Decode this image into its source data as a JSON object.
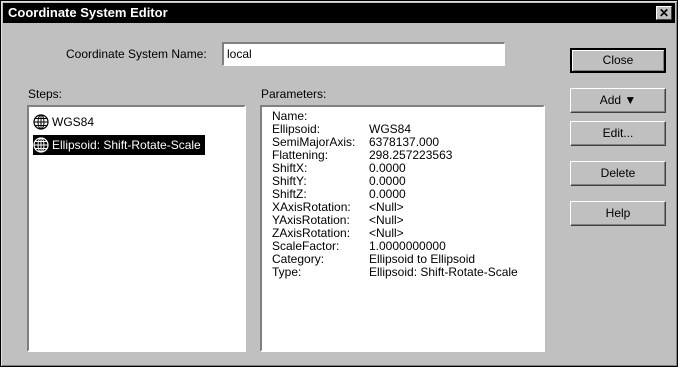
{
  "window": {
    "title": "Coordinate System Editor",
    "close_glyph": "✕"
  },
  "name_field": {
    "label": "Coordinate System Name:",
    "value": "local"
  },
  "steps": {
    "label": "Steps:",
    "items": [
      {
        "label": "WGS84",
        "icon": "globe-icon",
        "selected": false
      },
      {
        "label": "Ellipsoid: Shift-Rotate-Scale",
        "icon": "globe-icon",
        "selected": true
      }
    ]
  },
  "parameters": {
    "label": "Parameters:",
    "rows": [
      {
        "key": "Name:",
        "value": ""
      },
      {
        "key": "Ellipsoid:",
        "value": "WGS84"
      },
      {
        "key": "SemiMajorAxis:",
        "value": "6378137.000"
      },
      {
        "key": "Flattening:",
        "value": "298.257223563"
      },
      {
        "key": "ShiftX:",
        "value": "0.0000"
      },
      {
        "key": "ShiftY:",
        "value": "0.0000"
      },
      {
        "key": "ShiftZ:",
        "value": "0.0000"
      },
      {
        "key": "XAxisRotation:",
        "value": "<Null>"
      },
      {
        "key": "YAxisRotation:",
        "value": "<Null>"
      },
      {
        "key": "ZAxisRotation:",
        "value": "<Null>"
      },
      {
        "key": "ScaleFactor:",
        "value": "1.0000000000"
      },
      {
        "key": "Category:",
        "value": "Ellipsoid to Ellipsoid"
      },
      {
        "key": "Type:",
        "value": "Ellipsoid: Shift-Rotate-Scale"
      }
    ]
  },
  "buttons": {
    "close": "Close",
    "add": "Add ▼",
    "edit": "Edit...",
    "delete": "Delete",
    "help": "Help"
  }
}
